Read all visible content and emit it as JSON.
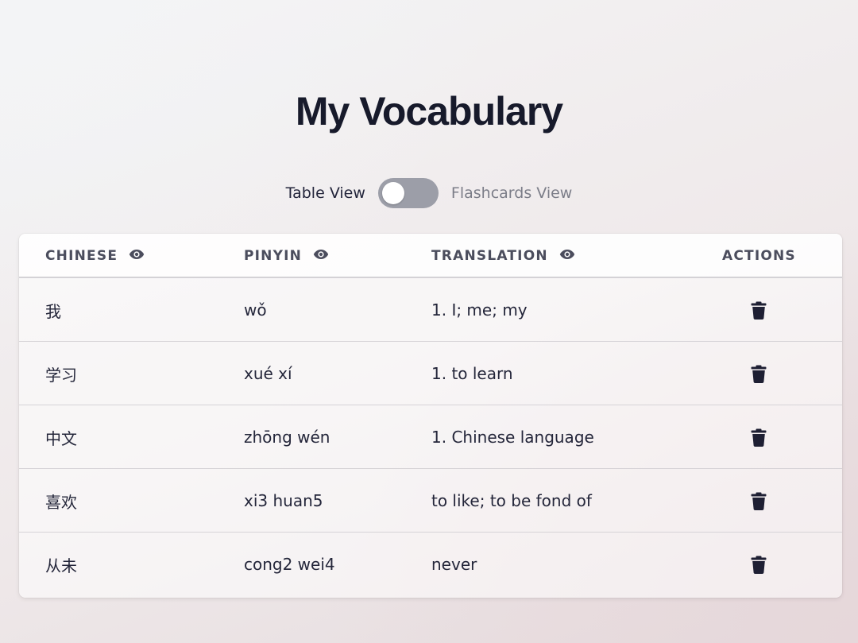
{
  "page": {
    "title": "My Vocabulary"
  },
  "view_toggle": {
    "left_label": "Table View",
    "right_label": "Flashcards View",
    "state": "table"
  },
  "table": {
    "headers": {
      "chinese": "CHINESE",
      "pinyin": "PINYIN",
      "translation": "TRANSLATION",
      "actions": "ACTIONS"
    },
    "header_icons": [
      "eye-icon",
      "eye-icon",
      "eye-icon"
    ],
    "rows": [
      {
        "chinese": "我",
        "pinyin": "wǒ",
        "translation": "1. I; me; my"
      },
      {
        "chinese": "学习",
        "pinyin": "xué xí",
        "translation": "1. to learn"
      },
      {
        "chinese": "中文",
        "pinyin": "zhōng wén",
        "translation": "1. Chinese language"
      },
      {
        "chinese": "喜欢",
        "pinyin": "xi3 huan5",
        "translation": "to like; to be fond of"
      },
      {
        "chinese": "从未",
        "pinyin": "cong2 wei4",
        "translation": "never"
      }
    ],
    "row_action_icon": "trash-icon"
  },
  "colors": {
    "title": "#171a2b",
    "text": "#24263a",
    "header_text": "#4b4d5d",
    "toggle_track": "#9c9ea8",
    "muted_label": "#7b7d88",
    "icon": "#1e1f33"
  }
}
